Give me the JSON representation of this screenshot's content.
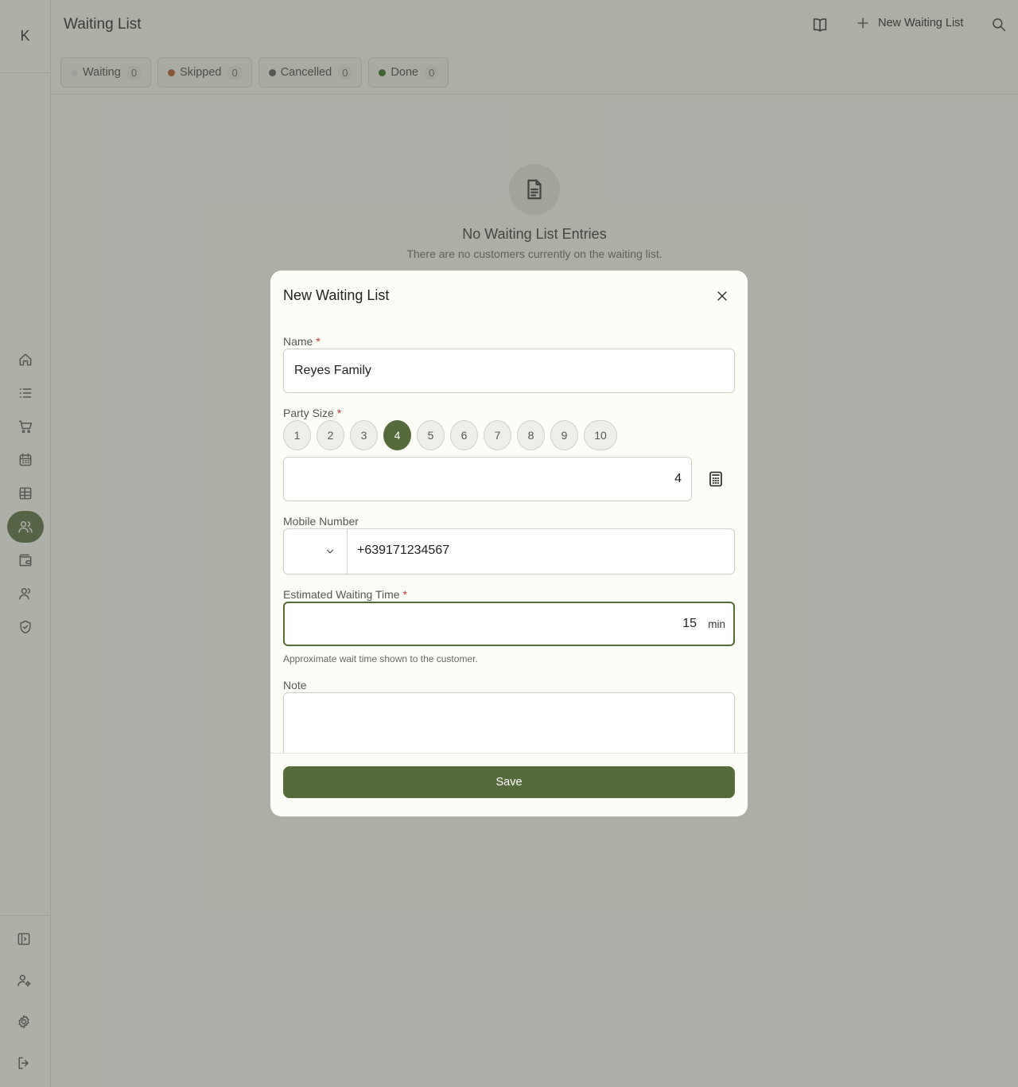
{
  "app": {
    "logo_text": "K",
    "page_title": "Waiting List"
  },
  "header": {
    "new_label": "New Waiting List"
  },
  "tabs": [
    {
      "label": "Waiting",
      "count": "0",
      "color": "#e0e0dc"
    },
    {
      "label": "Skipped",
      "count": "0",
      "color": "#b5541f"
    },
    {
      "label": "Cancelled",
      "count": "0",
      "color": "#555555"
    },
    {
      "label": "Done",
      "count": "0",
      "color": "#2e6b1f"
    }
  ],
  "empty_state": {
    "heading": "No Waiting List Entries",
    "subtext": "There are no customers currently on the waiting list."
  },
  "sidebar": {
    "items": [
      "home-icon",
      "list-icon",
      "cart-icon",
      "calendar-icon",
      "table-icon",
      "users-icon",
      "wallet-icon",
      "customers-icon",
      "shield-icon"
    ],
    "active": "users-icon",
    "bottom_items": [
      "sidebar-toggle-icon",
      "user-settings-icon",
      "gear-icon",
      "logout-icon"
    ]
  },
  "modal": {
    "title": "New Waiting List",
    "name_label": "Name",
    "name_value": "Reyes Family",
    "party_label": "Party Size",
    "party_options": [
      "1",
      "2",
      "3",
      "4",
      "5",
      "6",
      "7",
      "8",
      "9",
      "10"
    ],
    "party_selected": "4",
    "party_value": "4",
    "mobile_label": "Mobile Number",
    "mobile_value": "+639171234567",
    "wait_label": "Estimated Waiting Time",
    "wait_value": "15",
    "wait_unit": "min",
    "wait_hint": "Approximate wait time shown to the customer.",
    "note_label": "Note",
    "note_value": "",
    "required_mark": "*",
    "save_label": "Save"
  },
  "colors": {
    "accent": "#556b3a",
    "required": "#c0392b"
  }
}
